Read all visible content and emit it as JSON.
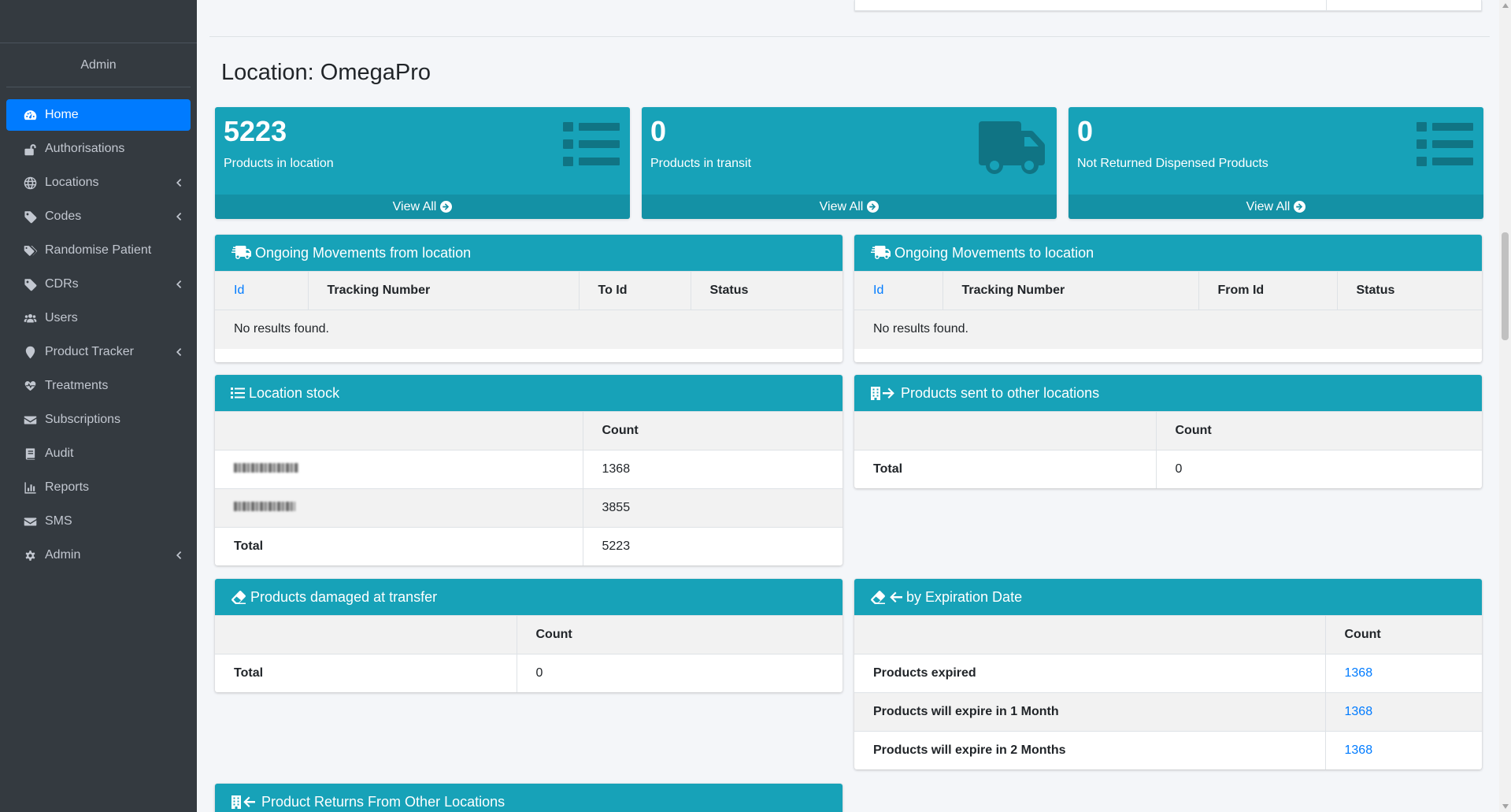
{
  "sidebar": {
    "user": "Admin",
    "items": [
      {
        "label": "Home",
        "icon": "tachometer-icon",
        "active": true,
        "chevron": false
      },
      {
        "label": "Authorisations",
        "icon": "unlock-icon",
        "chevron": false
      },
      {
        "label": "Locations",
        "icon": "globe-icon",
        "chevron": true
      },
      {
        "label": "Codes",
        "icon": "tag-icon",
        "chevron": true
      },
      {
        "label": "Randomise Patient",
        "icon": "tags-icon",
        "chevron": false
      },
      {
        "label": "CDRs",
        "icon": "tag-icon",
        "chevron": true
      },
      {
        "label": "Users",
        "icon": "users-icon",
        "chevron": false
      },
      {
        "label": "Product Tracker",
        "icon": "map-marker-icon",
        "chevron": true
      },
      {
        "label": "Treatments",
        "icon": "heartbeat-icon",
        "chevron": false
      },
      {
        "label": "Subscriptions",
        "icon": "envelope-icon",
        "chevron": false
      },
      {
        "label": "Audit",
        "icon": "book-icon",
        "chevron": false
      },
      {
        "label": "Reports",
        "icon": "chart-bar-icon",
        "chevron": false
      },
      {
        "label": "SMS",
        "icon": "envelope-icon",
        "chevron": false
      },
      {
        "label": "Admin",
        "icon": "cog-icon",
        "chevron": true
      }
    ]
  },
  "location": {
    "title": "Location: OmegaPro"
  },
  "boxes": [
    {
      "value": "5223",
      "label": "Products in location",
      "link": "View All",
      "icon": "list-icon"
    },
    {
      "value": "0",
      "label": "Products in transit",
      "link": "View All",
      "icon": "truck-icon"
    },
    {
      "value": "0",
      "label": "Not Returned Dispensed Products",
      "link": "View All",
      "icon": "list-icon"
    }
  ],
  "movements_from": {
    "title": "Ongoing Movements from location",
    "columns": [
      "Id",
      "Tracking Number",
      "To Id",
      "Status"
    ],
    "empty": "No results found."
  },
  "movements_to": {
    "title": "Ongoing Movements to location",
    "columns": [
      "Id",
      "Tracking Number",
      "From Id",
      "Status"
    ],
    "empty": "No results found."
  },
  "stock": {
    "title": "Location stock",
    "count_header": "Count",
    "rows": [
      {
        "name": "",
        "count": "1368"
      },
      {
        "name": "",
        "count": "3855"
      }
    ],
    "total_label": "Total",
    "total": "5223"
  },
  "sent": {
    "title": "Products sent to other locations",
    "count_header": "Count",
    "total_label": "Total",
    "total": "0"
  },
  "damaged": {
    "title": "Products damaged at transfer",
    "count_header": "Count",
    "total_label": "Total",
    "total": "0"
  },
  "expiration": {
    "title": "by Expiration Date",
    "count_header": "Count",
    "rows": [
      {
        "label": "Products expired",
        "count": "1368"
      },
      {
        "label": "Products will expire in 1 Month",
        "count": "1368"
      },
      {
        "label": "Products will expire in 2 Months",
        "count": "1368"
      }
    ]
  },
  "returns": {
    "title": "Product Returns From Other Locations"
  },
  "colors": {
    "sidebar": "#343a40",
    "accent": "#17a2b8",
    "active": "#007bff",
    "link": "#007bff"
  }
}
